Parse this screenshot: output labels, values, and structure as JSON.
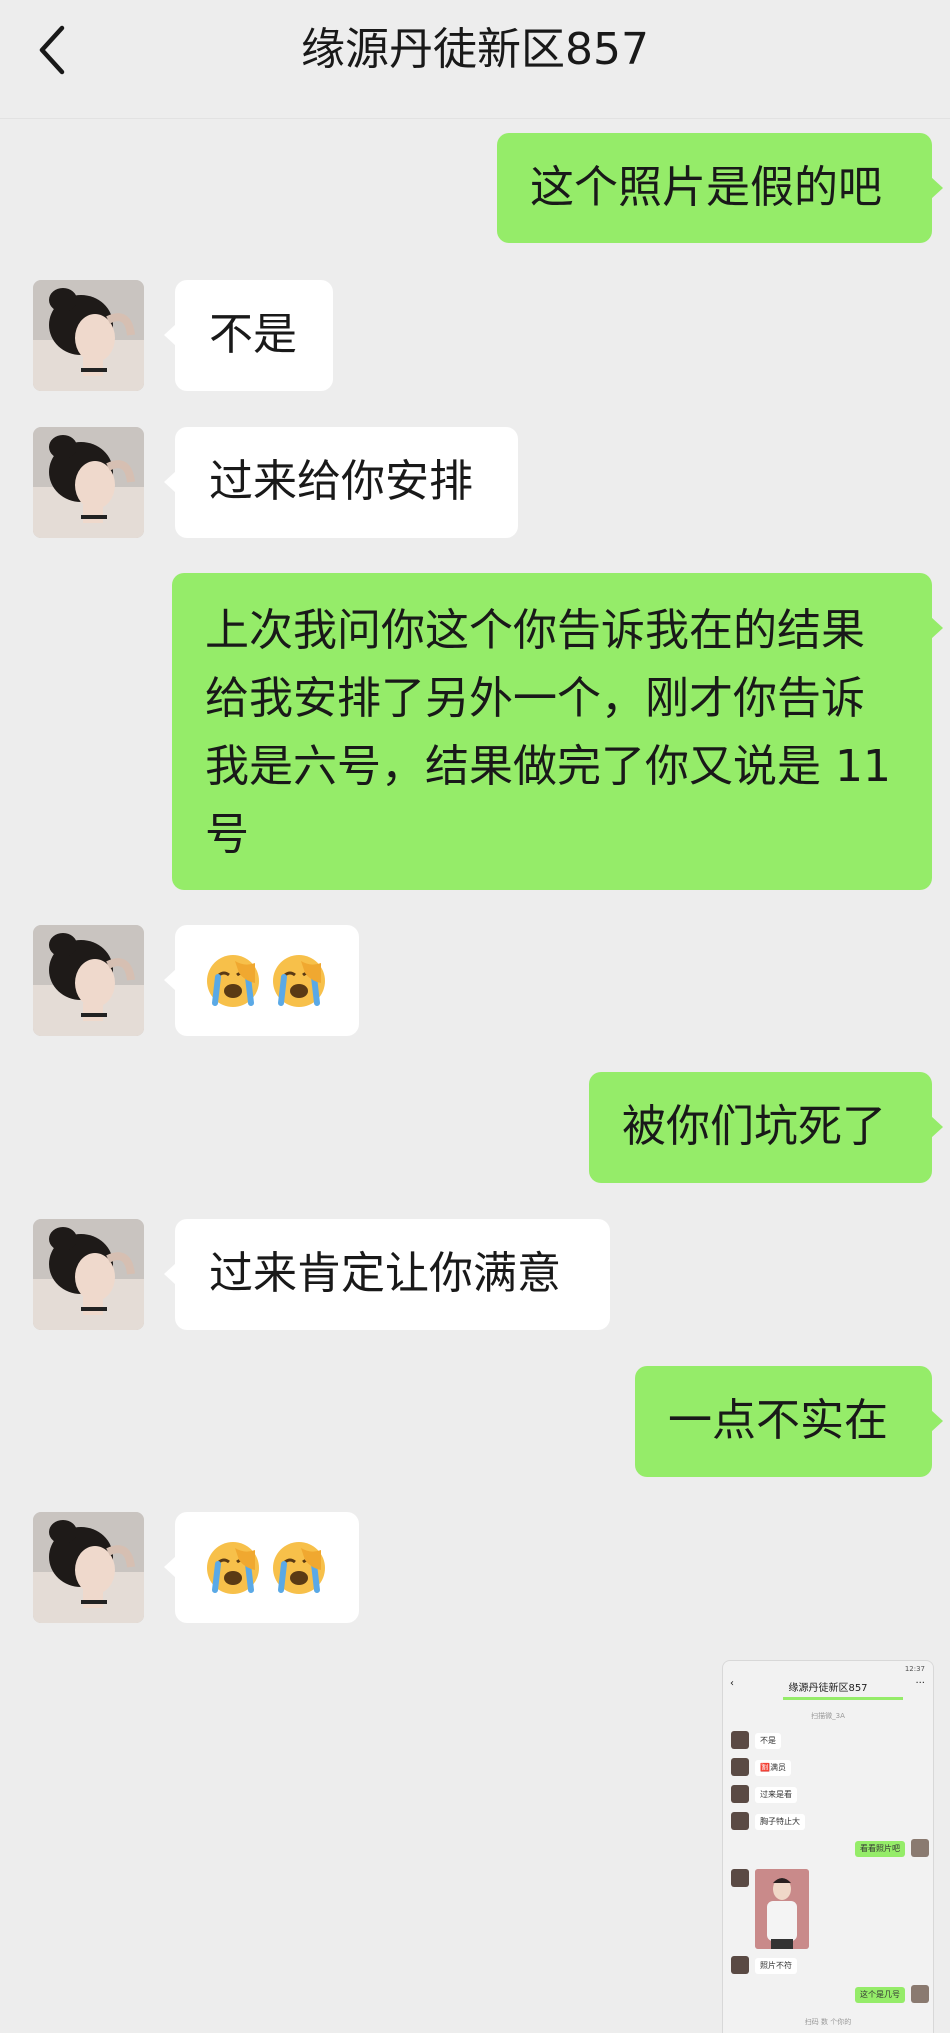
{
  "header": {
    "title": "缘源丹徒新区857"
  },
  "messages": [
    {
      "side": "right",
      "text": "这个照片是假的吧"
    },
    {
      "side": "left",
      "text": "不是"
    },
    {
      "side": "left",
      "text": "过来给你安排"
    },
    {
      "side": "right",
      "lines": [
        "上次我问你这个你告诉我在的结果",
        "给我安排了另外一个，刚才你告诉",
        "我是六号，结果做完了你又说是 11",
        "号"
      ]
    },
    {
      "side": "left",
      "emoji": [
        "loudly-crying-face",
        "loudly-crying-face"
      ]
    },
    {
      "side": "right",
      "text": "被你们坑死了"
    },
    {
      "side": "left",
      "text": "过来肯定让你满意"
    },
    {
      "side": "right",
      "text": "一点不实在"
    },
    {
      "side": "left",
      "emoji": [
        "loudly-crying-face",
        "loudly-crying-face"
      ]
    }
  ],
  "thumbnail": {
    "title": "缘源丹徒新区857",
    "time": "12:37",
    "note_top": "扫描微_3A",
    "bubbles": [
      {
        "side": "left",
        "text": "不是"
      },
      {
        "side": "left",
        "text": "🈹满员"
      },
      {
        "side": "left",
        "text": "过来是看"
      },
      {
        "side": "left",
        "text": "胸子特止大"
      },
      {
        "side": "right",
        "text": "看看照片吧"
      },
      {
        "side": "left",
        "text": "照片不符"
      },
      {
        "side": "right",
        "text": "这个是几号"
      }
    ],
    "note_bottom": "扫码 数 个你的"
  },
  "colors": {
    "background": "#ededed",
    "bubble_right": "#95ec69",
    "bubble_left": "#ffffff"
  }
}
